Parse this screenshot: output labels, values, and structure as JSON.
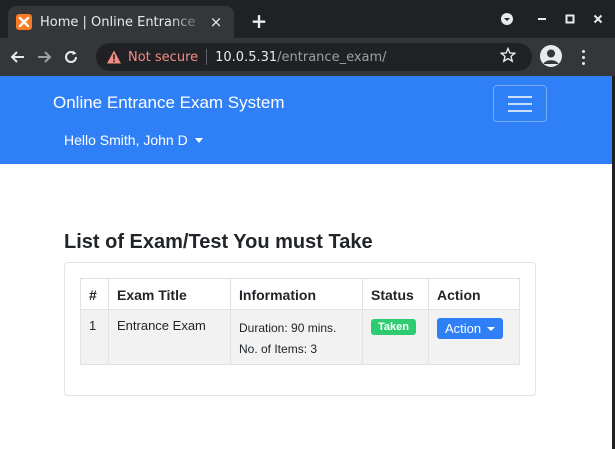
{
  "browser": {
    "tab_title": "Home | Online Entrance Exam System",
    "tab_close_glyph": "×",
    "new_tab_glyph": "+",
    "not_secure_label": "Not secure",
    "url_host": "10.0.5.31",
    "url_path": "/entrance_exam/",
    "icons": [
      "xampp-favicon-icon",
      "back-arrow-icon",
      "forward-arrow-icon",
      "reload-icon",
      "warning-icon",
      "star-icon",
      "account-icon",
      "menu-dots-icon"
    ]
  },
  "navbar": {
    "brand": "Online Entrance Exam System",
    "user_greeting": "Hello Smith, John D",
    "color": "#2f7ff7"
  },
  "main": {
    "title": "List of Exam/Test You must Take",
    "table": {
      "headers": [
        "#",
        "Exam Title",
        "Information",
        "Status",
        "Action"
      ],
      "rows": [
        {
          "num": "1",
          "exam_title": "Entrance Exam",
          "duration": "Duration: 90 mins.",
          "items": "No. of Items: 3",
          "status": "Taken",
          "action": "Action"
        }
      ]
    }
  },
  "colors": {
    "status_taken": "#2ecc71",
    "action_button": "#2f7ff7"
  }
}
